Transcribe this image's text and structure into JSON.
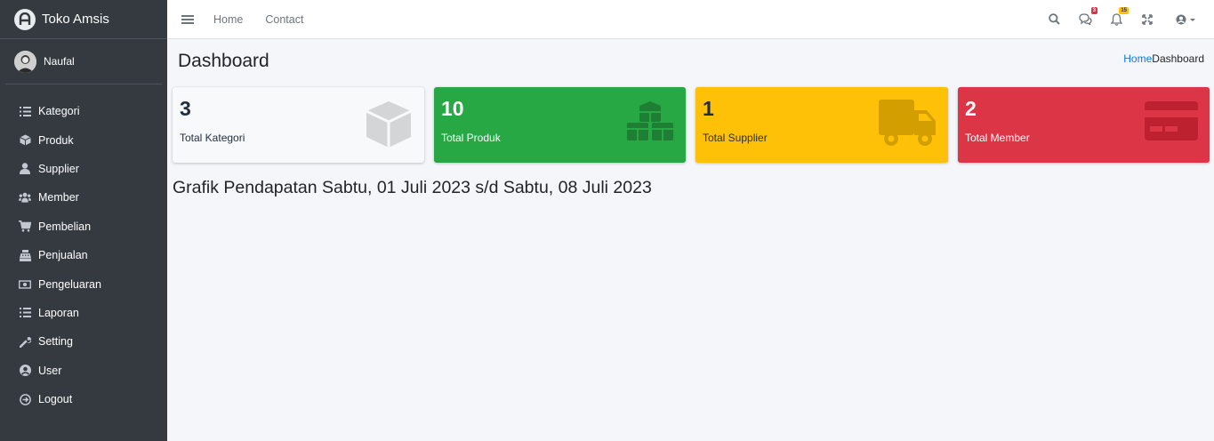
{
  "brand": {
    "title": "Toko Amsis"
  },
  "user": {
    "name": "Naufal"
  },
  "sidebar": {
    "items": [
      {
        "label": "Kategori",
        "icon": "list-icon"
      },
      {
        "label": "Produk",
        "icon": "cube-icon"
      },
      {
        "label": "Supplier",
        "icon": "user-icon"
      },
      {
        "label": "Member",
        "icon": "users-icon"
      },
      {
        "label": "Pembelian",
        "icon": "cart-icon"
      },
      {
        "label": "Penjualan",
        "icon": "register-icon"
      },
      {
        "label": "Pengeluaran",
        "icon": "money-icon"
      },
      {
        "label": "Laporan",
        "icon": "list-icon"
      },
      {
        "label": "Setting",
        "icon": "wrench-icon"
      },
      {
        "label": "User",
        "icon": "user-circle-icon"
      },
      {
        "label": "Logout",
        "icon": "sign-out-icon"
      }
    ]
  },
  "topbar": {
    "links": [
      "Home",
      "Contact"
    ],
    "messages_badge": "3",
    "notifications_badge": "15"
  },
  "header": {
    "title": "Dashboard",
    "breadcrumb": {
      "home": "Home",
      "current": "Dashboard"
    }
  },
  "stats": [
    {
      "value": "3",
      "label": "Total Kategori",
      "color": "#f8f9fa",
      "icon": "cube-icon"
    },
    {
      "value": "10",
      "label": "Total Produk",
      "color": "#28a745",
      "icon": "cubes-icon"
    },
    {
      "value": "1",
      "label": "Total Supplier",
      "color": "#ffc107",
      "icon": "truck-icon"
    },
    {
      "value": "2",
      "label": "Total Member",
      "color": "#dc3545",
      "icon": "credit-card-icon"
    }
  ],
  "chart": {
    "title": "Grafik Pendapatan Sabtu, 01 Juli 2023 s/d Sabtu, 08 Juli 2023"
  }
}
